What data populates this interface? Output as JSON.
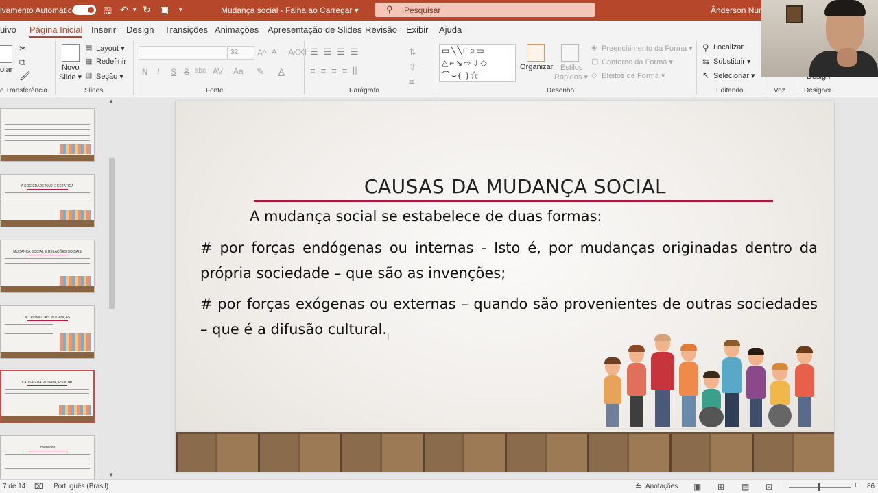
{
  "titlebar": {
    "autosave_label": "lvamento Automático",
    "doc_title": "Mudança social  -  Falha ao Carregar",
    "doc_title_caret": "▾",
    "search_placeholder": "Pesquisar",
    "user_name": "Ânderson Nunes",
    "qat_icons": [
      "save-icon",
      "undo-icon",
      "redo-icon",
      "present-icon",
      "customize-icon"
    ]
  },
  "tabs": [
    "uivo",
    "Página Inicial",
    "Inserir",
    "Design",
    "Transições",
    "Animações",
    "Apresentação de Slides",
    "Revisão",
    "Exibir",
    "Ajuda"
  ],
  "active_tab": "Página Inicial",
  "ribbon": {
    "clipboard": {
      "paste_label_1": "olar",
      "group": "e Transferência"
    },
    "slides": {
      "new_slide": "Novo",
      "new_slide_2": "Slide ▾",
      "layout": "Layout ▾",
      "reset": "Redefinir",
      "section": "Seção ▾",
      "group": "Slides"
    },
    "font": {
      "font_size": "32",
      "bold": "N",
      "italic": "I",
      "underline": "S",
      "strike": "S",
      "shadow": "abc",
      "group": "Fonte"
    },
    "paragraph": {
      "group": "Parágrafo"
    },
    "drawing": {
      "arrange": "Organizar",
      "quick_styles_1": "Estilos",
      "quick_styles_2": "Rápidos ▾",
      "shape_fill": "Preenchimento da Forma ▾",
      "shape_outline": "Contorno da Forma ▾",
      "shape_effects": "Efeitos de Forma ▾",
      "group": "Desenho"
    },
    "editing": {
      "find": "Localizar",
      "replace": "Substituir ▾",
      "select": "Selecionar ▾",
      "group": "Editando"
    },
    "voice": {
      "group": "Voz"
    },
    "designer": {
      "label": "Design",
      "group": "Designer"
    }
  },
  "thumbnails": [
    {
      "title": ""
    },
    {
      "title": "A SOCIEDADE NÃO É ESTÁTICA"
    },
    {
      "title": "MUDANÇA SOCIAL E RELAÇÕES SOCIAIS"
    },
    {
      "title": "NO RITMO DAS MUDANÇAS"
    },
    {
      "title": "CAUSAS DA MUDANÇA SOCIAL",
      "selected": true
    },
    {
      "title": "Invenções"
    }
  ],
  "slide": {
    "title": "CAUSAS DA MUDANÇA SOCIAL",
    "intro": "A mudança social se estabelece de duas formas:",
    "point1": "# por forças endógenas ou internas  - Isto é, por mudanças originadas dentro da própria sociedade – que são as invenções;",
    "point2": "# por forças exógenas ou externas – quando são provenientes de outras sociedades – que é a difusão cultural.",
    "accent_color": "#a61c3c"
  },
  "status": {
    "slide_count": "7 de 14",
    "language": "Português (Brasil)",
    "notes": "Anotações",
    "zoom": "86"
  }
}
